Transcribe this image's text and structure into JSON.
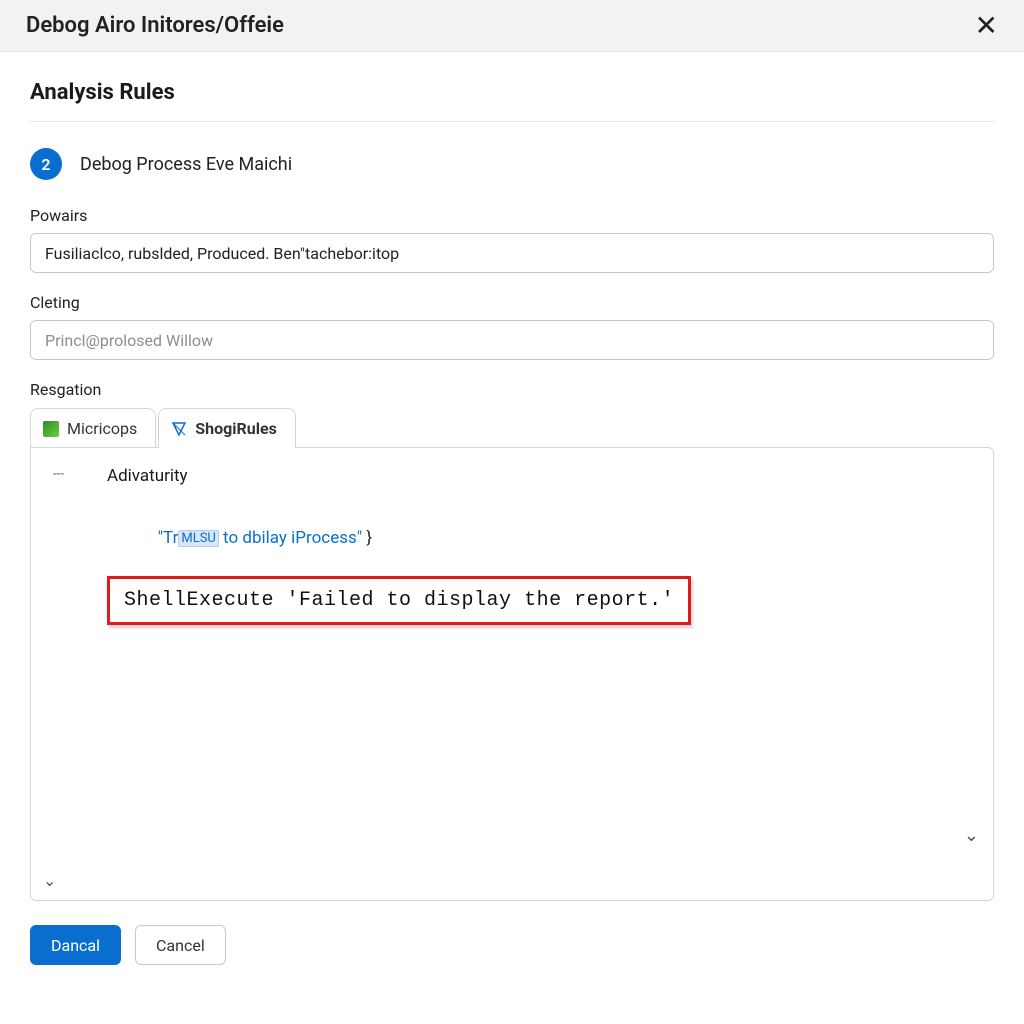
{
  "titlebar": {
    "title": "Debog Airo Initores/Offeie"
  },
  "section": {
    "heading": "Analysis Rules"
  },
  "step": {
    "number": "2",
    "label": "Debog Process Eve Maichi"
  },
  "fields": {
    "powairs": {
      "label": "Powairs",
      "value": "Fusiliaclco, rubslded, Produced. Ben\"tachebor:itop"
    },
    "cleting": {
      "label": "Cleting",
      "placeholder": "Princl@prolosed Willow"
    },
    "resgation": {
      "label": "Resgation"
    }
  },
  "tabs": {
    "micricops": "Micricops",
    "shogirules": "ShogiRules"
  },
  "editor": {
    "heading": "Adivaturity",
    "line_badge": "MLSU",
    "line_string_prefix": "\"Tr",
    "line_string_tail": " to dbilay iProcess\"",
    "line_tail": " }",
    "highlight": "ShellExecute 'Failed to display the report.'"
  },
  "buttons": {
    "primary": "Dancal",
    "cancel": "Cancel"
  }
}
